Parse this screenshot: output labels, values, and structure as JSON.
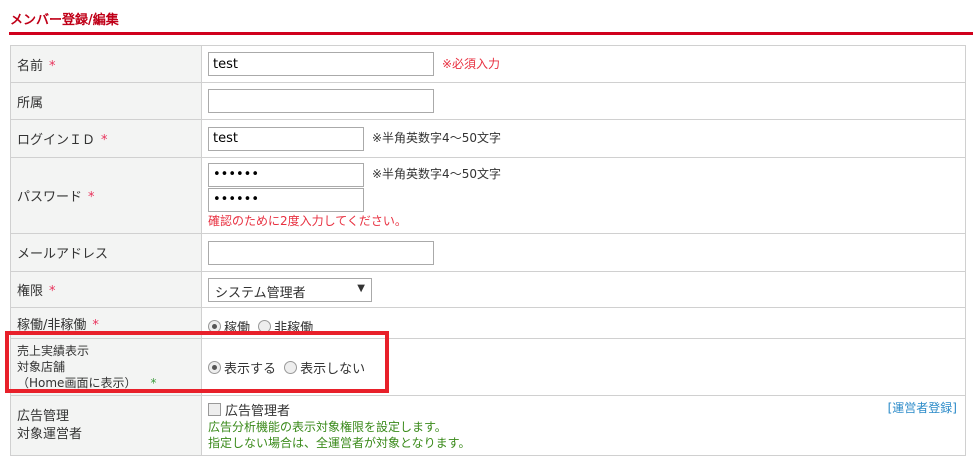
{
  "title": "メンバー登録/編集",
  "rows": {
    "name": {
      "label": "名前",
      "req": "*",
      "value": "test",
      "note": "※必須入力"
    },
    "dept": {
      "label": "所属",
      "value": ""
    },
    "login": {
      "label": "ログインＩＤ",
      "req": "*",
      "value": "test",
      "note": "※半角英数字4～50文字"
    },
    "password": {
      "label": "パスワード",
      "req": "*",
      "value": "••••••",
      "confirm": "••••••",
      "note": "※半角英数字4～50文字",
      "confirm_note": "確認のために2度入力してください。"
    },
    "email": {
      "label": "メールアドレス",
      "value": ""
    },
    "role": {
      "label": "権限",
      "req": "*",
      "selected": "システム管理者"
    },
    "active": {
      "label": "稼働/非稼働",
      "req": "*",
      "opt1": "稼働",
      "opt2": "非稼働"
    },
    "sales": {
      "label1": "売上実績表示",
      "label2": "対象店舗",
      "label3": "（Home画面に表示）",
      "req": "*",
      "opt1": "表示する",
      "opt2": "表示しない"
    },
    "ads": {
      "label1": "広告管理",
      "label2": "対象運営者",
      "checkbox": "広告管理者",
      "help1": "広告分析機能の表示対象権限を設定します。",
      "help2": "指定しない場合は、全運営者が対象となります。",
      "link": "[運営者登録]"
    }
  }
}
